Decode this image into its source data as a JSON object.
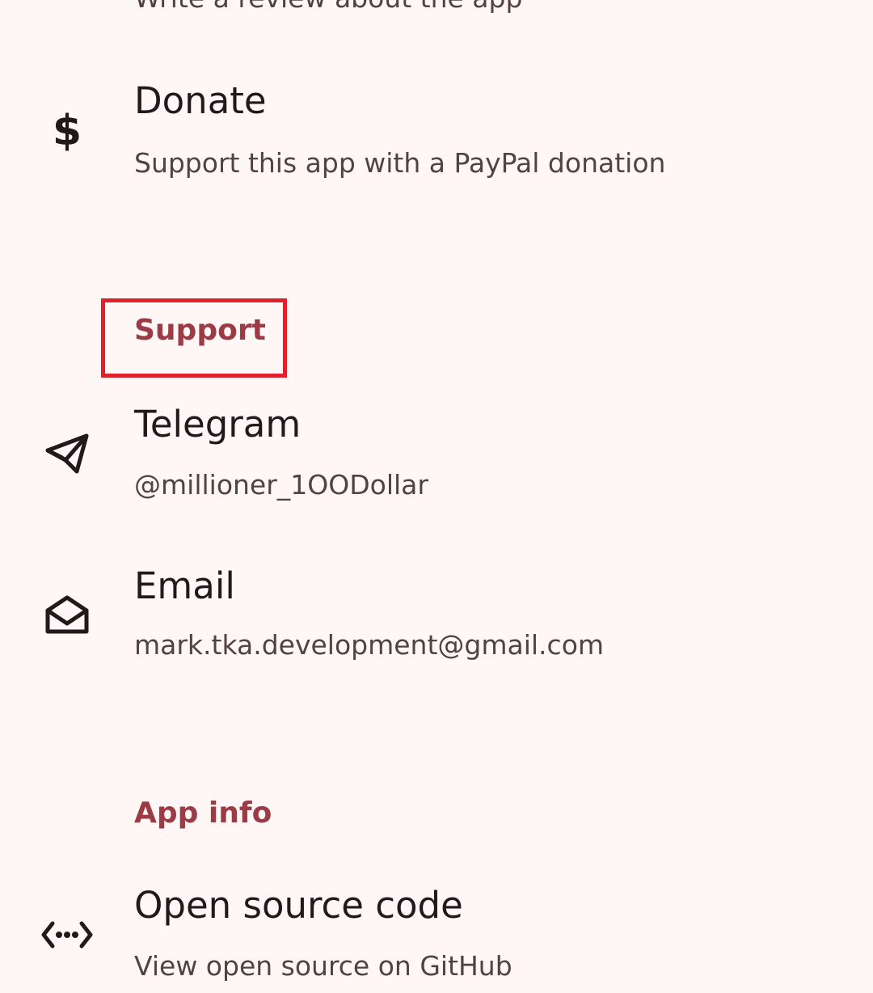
{
  "rate": {
    "subtitle": "Write a review about the app"
  },
  "donate": {
    "title": "Donate",
    "subtitle": "Support this app with a PayPal donation",
    "icon": "dollar-icon"
  },
  "support_section": {
    "header": "Support",
    "highlight_color": "#e0202b"
  },
  "telegram": {
    "title": "Telegram",
    "subtitle": "@millioner_1OODollar",
    "icon": "telegram-icon"
  },
  "email": {
    "title": "Email",
    "subtitle": "mark.tka.development@gmail.com",
    "icon": "email-icon"
  },
  "app_info_section": {
    "header": "App info"
  },
  "open_source": {
    "title": "Open source code",
    "subtitle": "View open source on GitHub",
    "icon": "code-icon"
  },
  "colors": {
    "background": "#fff7f5",
    "accent": "#9a3b46",
    "primary_text": "#221a1a",
    "secondary_text": "#524343"
  }
}
